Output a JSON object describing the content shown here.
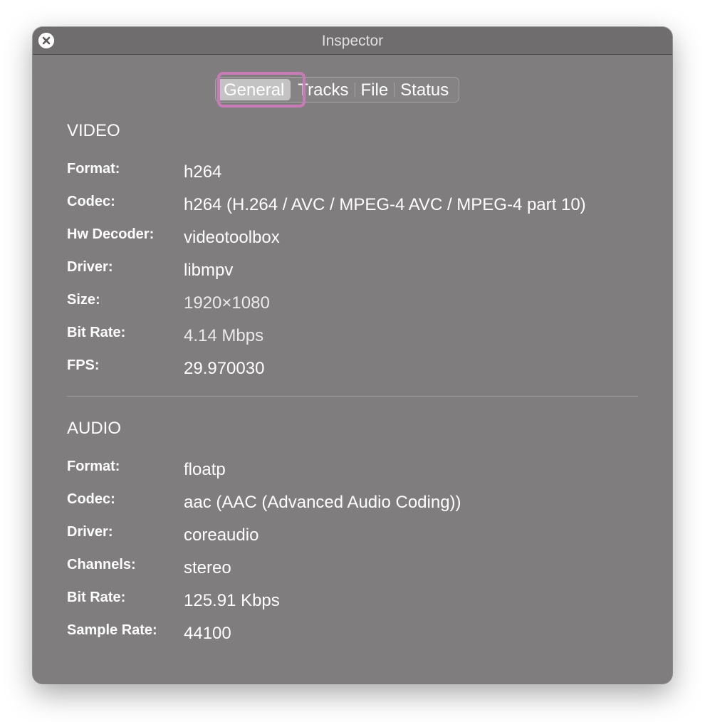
{
  "window": {
    "title": "Inspector"
  },
  "tabs": [
    {
      "label": "General",
      "selected": true
    },
    {
      "label": "Tracks",
      "selected": false
    },
    {
      "label": "File",
      "selected": false
    },
    {
      "label": "Status",
      "selected": false
    }
  ],
  "video": {
    "heading": "VIDEO",
    "rows": [
      {
        "label": "Format:",
        "value": "h264"
      },
      {
        "label": "Codec:",
        "value": "h264 (H.264 / AVC / MPEG-4 AVC / MPEG-4 part 10)"
      },
      {
        "label": "Hw Decoder:",
        "value": "videotoolbox"
      },
      {
        "label": "Driver:",
        "value": "libmpv"
      },
      {
        "label": "Size:",
        "value": "1920×1080"
      },
      {
        "label": "Bit Rate:",
        "value": "4.14 Mbps"
      },
      {
        "label": "FPS:",
        "value": "29.970030"
      }
    ]
  },
  "audio": {
    "heading": "AUDIO",
    "rows": [
      {
        "label": "Format:",
        "value": "floatp"
      },
      {
        "label": "Codec:",
        "value": "aac (AAC (Advanced Audio Coding))"
      },
      {
        "label": "Driver:",
        "value": "coreaudio"
      },
      {
        "label": "Channels:",
        "value": "stereo"
      },
      {
        "label": "Bit Rate:",
        "value": "125.91 Kbps"
      },
      {
        "label": "Sample Rate:",
        "value": "44100"
      }
    ]
  },
  "colors": {
    "window_bg": "#7f7d7e",
    "titlebar_bg": "#6f6d6e",
    "focus_ring": "#c97bb8",
    "selected_tab_bg": "#c4c3c4"
  },
  "icons": {
    "close": "close-icon"
  }
}
